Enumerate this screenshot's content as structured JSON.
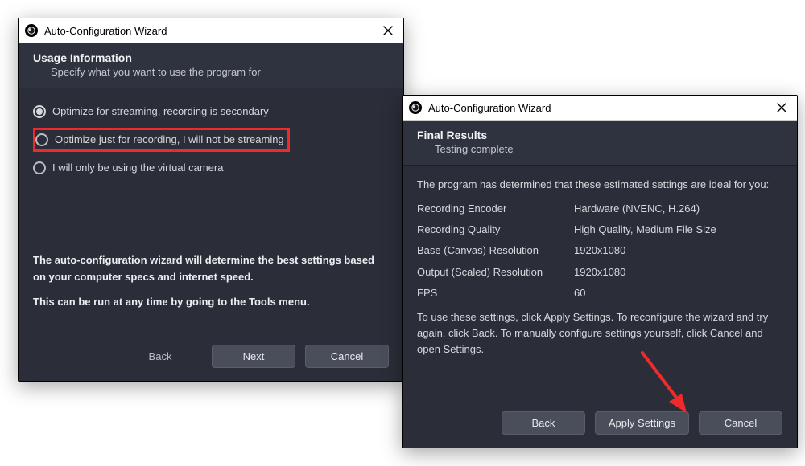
{
  "dlg1": {
    "window_title": "Auto-Configuration Wizard",
    "header_title": "Usage Information",
    "header_sub": "Specify what you want to use the program for",
    "options": [
      "Optimize for streaming, recording is secondary",
      "Optimize just for recording, I will not be streaming",
      "I will only be using the virtual camera"
    ],
    "info_line1": "The auto-configuration wizard will determine the best settings based on your computer specs and internet speed.",
    "info_line2": "This can be run at any time by going to the Tools menu.",
    "btn_back": "Back",
    "btn_next": "Next",
    "btn_cancel": "Cancel"
  },
  "dlg2": {
    "window_title": "Auto-Configuration Wizard",
    "header_title": "Final Results",
    "header_sub": "Testing complete",
    "lead": "The program has determined that these estimated settings are ideal for you:",
    "rows": {
      "rec_enc_k": "Recording Encoder",
      "rec_enc_v": "Hardware (NVENC, H.264)",
      "rec_q_k": "Recording Quality",
      "rec_q_v": "High Quality, Medium File Size",
      "base_k": "Base (Canvas) Resolution",
      "base_v": "1920x1080",
      "out_k": "Output (Scaled) Resolution",
      "out_v": "1920x1080",
      "fps_k": "FPS",
      "fps_v": "60"
    },
    "trail": "To use these settings, click Apply Settings. To reconfigure the wizard and try again, click Back. To manually configure settings yourself, click Cancel and open Settings.",
    "btn_back": "Back",
    "btn_apply": "Apply Settings",
    "btn_cancel": "Cancel"
  },
  "annotations": {
    "highlighted_option_index": 1,
    "arrow_color": "#ef2a2a"
  }
}
